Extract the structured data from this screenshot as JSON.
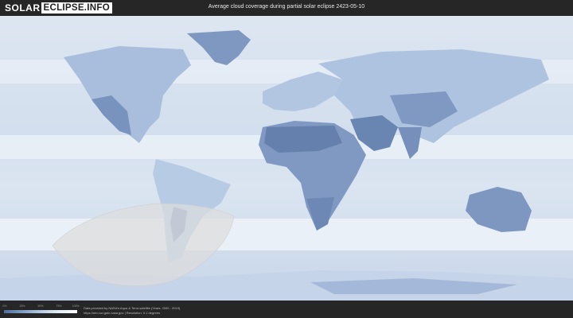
{
  "header": {
    "logo_part1": "SOLAR",
    "logo_part2": "ECLIPSE.INFO",
    "title": "Average cloud coverage during partial solar eclipse 2423-05-10"
  },
  "legend": {
    "ticks": [
      "0%",
      "25%",
      "50%",
      "75%",
      "100%"
    ],
    "gradient_colors": [
      "#4f6e9c",
      "#7f9dc4",
      "#b6cbe3",
      "#e4edf6",
      "#ffffff"
    ]
  },
  "footer": {
    "credit_line1": "Data provided by NASA's Aqua & Terra satellite (Years: 2000 - 2019)",
    "credit_line2": "https://neo.sci.gsfc.nasa.gov | Resolution: 0.1 degrees"
  },
  "colors": {
    "land_dark": "#6a86b2",
    "land_mid": "#9fb6d6",
    "cloud": "#dfe8f3",
    "eclipse_zone": "#d9d9d9"
  }
}
